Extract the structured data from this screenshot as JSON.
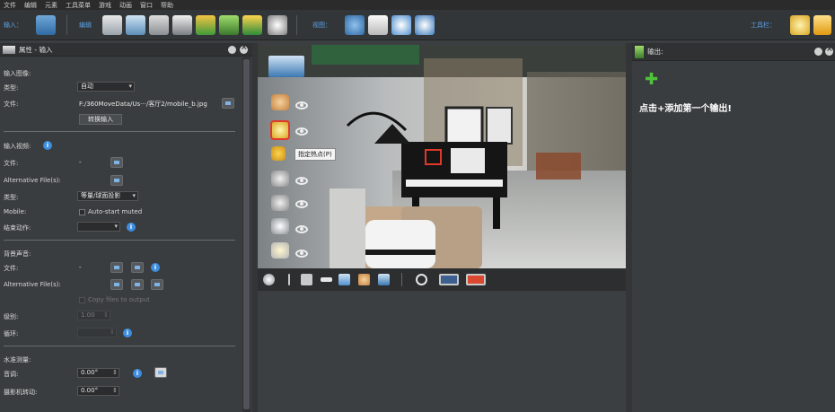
{
  "menu": [
    "文件",
    "编辑",
    "元素",
    "工具菜单",
    "游戏",
    "动画",
    "窗口",
    "帮助"
  ],
  "toolbar": {
    "input_label": "输入：",
    "edit_label": "编辑",
    "view_label": "视图：",
    "toolbar_label": "工具栏："
  },
  "left_panel": {
    "title": "属性 - 输入",
    "input_image_section": "输入图像:",
    "type_label": "类型:",
    "type_value": "自动",
    "file_label": "文件:",
    "file_value": "F:/360MoveData/Us···/客厅2/mobile_b.jpg",
    "convert_button": "转换输入",
    "input_video_section": "输入视频:",
    "video_file_label": "文件:",
    "video_file_value": "-",
    "alt_files_label": "Alternative File(s):",
    "video_type_label": "类型:",
    "video_type_value": "等量/球面投影",
    "mobile_label": "Mobile:",
    "autostart_label": "Auto-start muted",
    "end_action_label": "结束动作:",
    "bg_sound_section": "背景声音:",
    "sound_file_label": "文件:",
    "sound_file_value": "-",
    "sound_alt_label": "Alternative File(s):",
    "copy_files_label": "Copy files to output",
    "level_label": "级别:",
    "level_value": "1.00",
    "loop_label": "循环:",
    "level_measure_section": "水准测量:",
    "pitch_label": "音调:",
    "pitch_value": "0.00°",
    "camera_roll_label": "摄影机转动:",
    "camera_roll_value": "0.00°"
  },
  "viewer": {
    "tooltip": "指定热点(P)"
  },
  "right_panel": {
    "title": "输出:",
    "add_hint": "点击+添加第一个输出!"
  },
  "colors": {
    "accent_blue": "#3d8ee0",
    "label_blue": "#5aa0e6",
    "add_green": "#4fc13a",
    "highlight_red": "#e0392b"
  }
}
